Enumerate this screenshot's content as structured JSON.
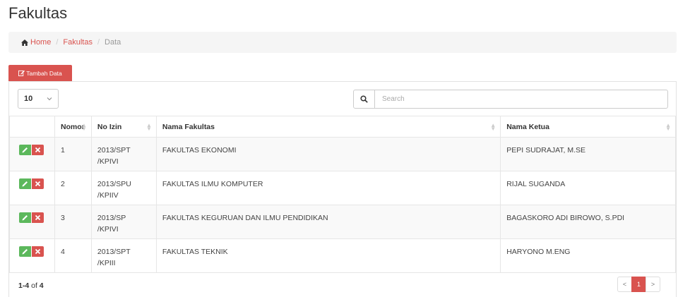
{
  "page": {
    "title": "Fakultas"
  },
  "breadcrumb": {
    "home": "Home",
    "section": "Fakultas",
    "current": "Data"
  },
  "toolbar": {
    "add_label": "Tambah Data"
  },
  "controls": {
    "per_page": "10",
    "search_placeholder": "Search"
  },
  "table": {
    "columns": [
      "",
      "Nomor",
      "No Izin",
      "Nama Fakultas",
      "Nama Ketua"
    ],
    "rows": [
      {
        "nomor": "1",
        "no_izin_a": "2013/SPT",
        "no_izin_b": "/KPIVI",
        "nama_fakultas": "FAKULTAS EKONOMI",
        "nama_ketua": "PEPI SUDRAJAT, M.SE"
      },
      {
        "nomor": "2",
        "no_izin_a": "2013/SPU",
        "no_izin_b": "/KPIIV",
        "nama_fakultas": "FAKULTAS ILMU KOMPUTER",
        "nama_ketua": "RIJAL SUGANDA"
      },
      {
        "nomor": "3",
        "no_izin_a": "2013/SP",
        "no_izin_b": "/KPIVI",
        "nama_fakultas": "FAKULTAS KEGURUAN DAN ILMU PENDIDIKAN",
        "nama_ketua": "BAGASKORO ADI BIROWO, S.PDI"
      },
      {
        "nomor": "4",
        "no_izin_a": "2013/SPT",
        "no_izin_b": "/KPIII",
        "nama_fakultas": "FAKULTAS TEKNIK",
        "nama_ketua": "HARYONO M.ENG"
      }
    ]
  },
  "footer": {
    "range": "1-4",
    "of_label": "of",
    "total": "4"
  },
  "pagination": {
    "prev": "<",
    "page": "1",
    "next": ">"
  },
  "colors": {
    "accent": "#d9534f",
    "success": "#5cb85c"
  }
}
